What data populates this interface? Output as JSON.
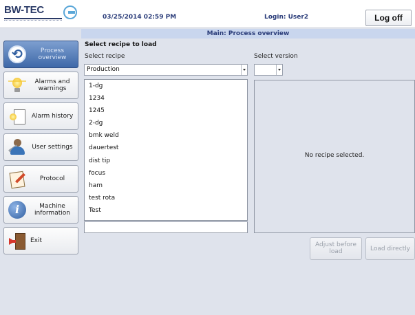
{
  "header": {
    "logo_text": "BW-TEC",
    "datetime": "03/25/2014 02:59 PM",
    "login": "Login: User2",
    "logoff_label": "Log off"
  },
  "title": "Main: Process overview",
  "sidebar": {
    "items": [
      {
        "label": "Process overview",
        "icon": "refresh-icon",
        "active": true
      },
      {
        "label": "Alarms and warnings",
        "icon": "lightbulb-icon",
        "active": false
      },
      {
        "label": "Alarm history",
        "icon": "alarm-history-icon",
        "active": false
      },
      {
        "label": "User settings",
        "icon": "user-settings-icon",
        "active": false
      },
      {
        "label": "Protocol",
        "icon": "protocol-icon",
        "active": false
      },
      {
        "label": "Machine information",
        "icon": "info-icon",
        "active": false
      },
      {
        "label": "Exit",
        "icon": "exit-icon",
        "active": false
      }
    ]
  },
  "main": {
    "heading": "Select recipe to load",
    "select_recipe_label": "Select recipe",
    "select_version_label": "Select version",
    "recipe_type": "Production",
    "version_value": "",
    "recipes": [
      "1-dg",
      "1234",
      "1245",
      "2-dg",
      "bmk weld",
      "dauertest",
      "dist tip",
      "focus",
      "ham",
      "test rota",
      "Test"
    ],
    "filter_value": "",
    "detail_message": "No recipe selected.",
    "adjust_label": "Adjust before load",
    "load_label": "Load directly"
  },
  "colors": {
    "brand": "#2a3a66",
    "accent": "#3e68a8",
    "title_strip": "#c9d6ee",
    "background": "#dfe3ec"
  }
}
